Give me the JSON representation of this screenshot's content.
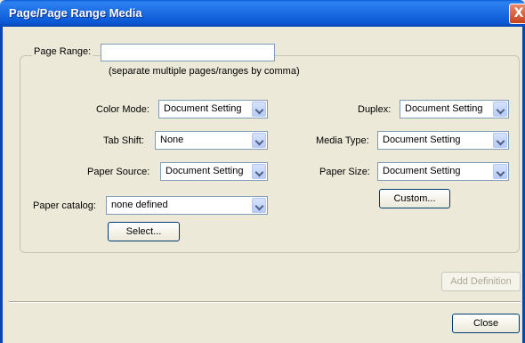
{
  "window": {
    "title": "Page/Page Range Media",
    "close_glyph": "X"
  },
  "page_range": {
    "label": "Page Range:",
    "value": "",
    "hint": "(separate multiple pages/ranges by comma)"
  },
  "color_mode": {
    "label": "Color Mode:",
    "value": "Document Setting"
  },
  "duplex": {
    "label": "Duplex:",
    "value": "Document Setting"
  },
  "tab_shift": {
    "label": "Tab Shift:",
    "value": "None"
  },
  "media_type": {
    "label": "Media Type:",
    "value": "Document Setting"
  },
  "paper_source": {
    "label": "Paper Source:",
    "value": "Document Setting"
  },
  "paper_size": {
    "label": "Paper Size:",
    "value": "Document Setting"
  },
  "custom_button": "Custom...",
  "paper_catalog": {
    "label": "Paper catalog:",
    "value": "none defined"
  },
  "select_button": "Select...",
  "add_definition_button": "Add Definition",
  "close_button": "Close"
}
